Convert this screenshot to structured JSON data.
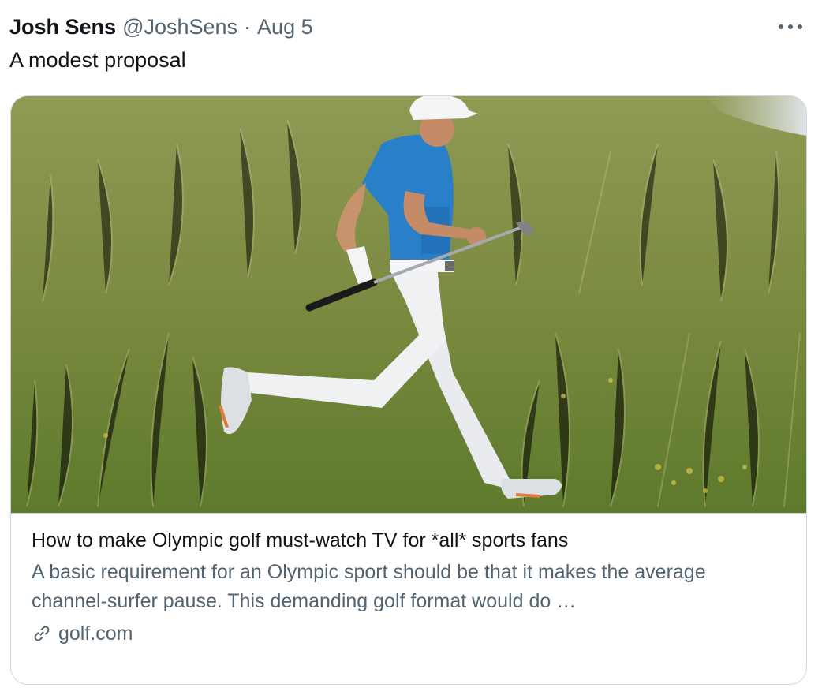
{
  "tweet": {
    "author_name": "Josh Sens",
    "author_handle": "@JoshSens",
    "separator": "·",
    "date": "Aug 5",
    "text": "A modest proposal",
    "more_icon": "more-horizontal-icon"
  },
  "card": {
    "title": "How to make Olympic golf must-watch TV for *all* sports fans",
    "description": "A basic requirement for an Olympic sport should be that it makes the average channel-surfer pause. This demanding golf format would do …",
    "domain": "golf.com",
    "domain_icon": "link-icon"
  },
  "colors": {
    "text_primary": "#0f1419",
    "text_secondary": "#536471",
    "border": "#cfd9de"
  }
}
